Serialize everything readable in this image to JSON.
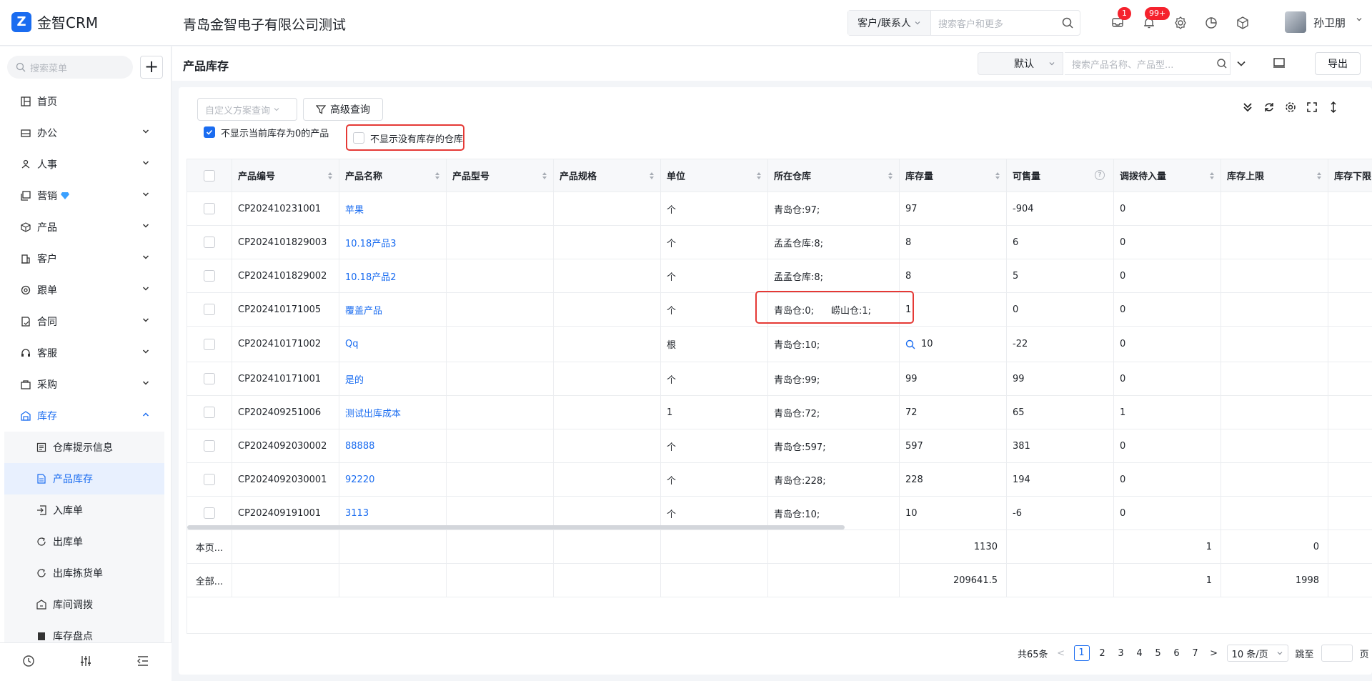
{
  "header": {
    "logo": "Z",
    "app_name": "金智CRM",
    "company": "青岛金智电子有限公司测试",
    "search_type": "客户/联系人",
    "search_placeholder": "搜索客户和更多",
    "msg_badge": "1",
    "notice_badge": "99+",
    "user_name": "孙卫朋"
  },
  "sidebar": {
    "search_placeholder": "搜索菜单",
    "add_label": "+",
    "items": [
      {
        "label": "首页"
      },
      {
        "label": "办公"
      },
      {
        "label": "人事"
      },
      {
        "label": "营销"
      },
      {
        "label": "产品"
      },
      {
        "label": "客户"
      },
      {
        "label": "跟单"
      },
      {
        "label": "合同"
      },
      {
        "label": "客服"
      },
      {
        "label": "采购"
      },
      {
        "label": "库存"
      }
    ],
    "sub_items": [
      {
        "label": "仓库提示信息"
      },
      {
        "label": "产品库存"
      },
      {
        "label": "入库单"
      },
      {
        "label": "出库单"
      },
      {
        "label": "出库拣货单"
      },
      {
        "label": "库间调拨"
      },
      {
        "label": "库存盘点"
      }
    ]
  },
  "page": {
    "title": "产品库存",
    "view_select": "默认",
    "search_placeholder": "搜索产品名称、产品型...",
    "export_label": "导出"
  },
  "filters": {
    "scheme_placeholder": "自定义方案查询",
    "advanced_label": "高级查询",
    "hide_zero_label": "不显示当前库存为0的产品",
    "hide_zero_checked": true,
    "hide_empty_wh_label": "不显示没有库存的仓库",
    "hide_empty_wh_checked": false
  },
  "table": {
    "columns": [
      "产品编号",
      "产品名称",
      "产品型号",
      "产品规格",
      "单位",
      "所在仓库",
      "库存量",
      "可售量",
      "调拨待入量",
      "库存上限",
      "库存下限"
    ],
    "rows": [
      {
        "code": "CP202410231001",
        "name": "苹果",
        "unit": "个",
        "warehouse": "青岛仓:97;",
        "stock": "97",
        "available": "-904",
        "transfer": "0"
      },
      {
        "code": "CP2024101829003",
        "name": "10.18产品3",
        "unit": "个",
        "warehouse": "孟孟仓库:8;",
        "stock": "8",
        "available": "6",
        "transfer": "0"
      },
      {
        "code": "CP2024101829002",
        "name": "10.18产品2",
        "unit": "个",
        "warehouse": "孟孟仓库:8;",
        "stock": "8",
        "available": "5",
        "transfer": "0"
      },
      {
        "code": "CP202410171005",
        "name": "覆盖产品",
        "unit": "个",
        "warehouse": "青岛仓:0;",
        "warehouse2": "崂山仓:1;",
        "stock": "1",
        "available": "0",
        "transfer": "0"
      },
      {
        "code": "CP202410171002",
        "name": "Qq",
        "unit": "根",
        "warehouse": "青岛仓:10;",
        "stock": "10",
        "available": "-22",
        "transfer": "0"
      },
      {
        "code": "CP202410171001",
        "name": "是的",
        "unit": "个",
        "warehouse": "青岛仓:99;",
        "stock": "99",
        "available": "99",
        "transfer": "0"
      },
      {
        "code": "CP202409251006",
        "name": "测试出库成本",
        "unit": "1",
        "warehouse": "青岛仓:72;",
        "stock": "72",
        "available": "65",
        "transfer": "1"
      },
      {
        "code": "CP2024092030002",
        "name": "88888",
        "unit": "个",
        "warehouse": "青岛仓:597;",
        "stock": "597",
        "available": "381",
        "transfer": "0"
      },
      {
        "code": "CP2024092030001",
        "name": "92220",
        "unit": "个",
        "warehouse": "青岛仓:228;",
        "stock": "228",
        "available": "194",
        "transfer": "0"
      },
      {
        "code": "CP202409191001",
        "name": "3113",
        "unit": "个",
        "warehouse": "青岛仓:10;",
        "stock": "10",
        "available": "-6",
        "transfer": "0"
      }
    ],
    "summary": [
      {
        "label": "本页...",
        "stock": "1130",
        "transfer": "1",
        "upper": "0"
      },
      {
        "label": "全部...",
        "stock": "209641.5",
        "transfer": "1",
        "upper": "1998"
      }
    ]
  },
  "pagination": {
    "total": "共65条",
    "prev": "<",
    "pages": [
      "1",
      "2",
      "3",
      "4",
      "5",
      "6",
      "7"
    ],
    "next": ">",
    "page_size": "10 条/页",
    "jump_label": "跳至",
    "page_unit": "页"
  }
}
